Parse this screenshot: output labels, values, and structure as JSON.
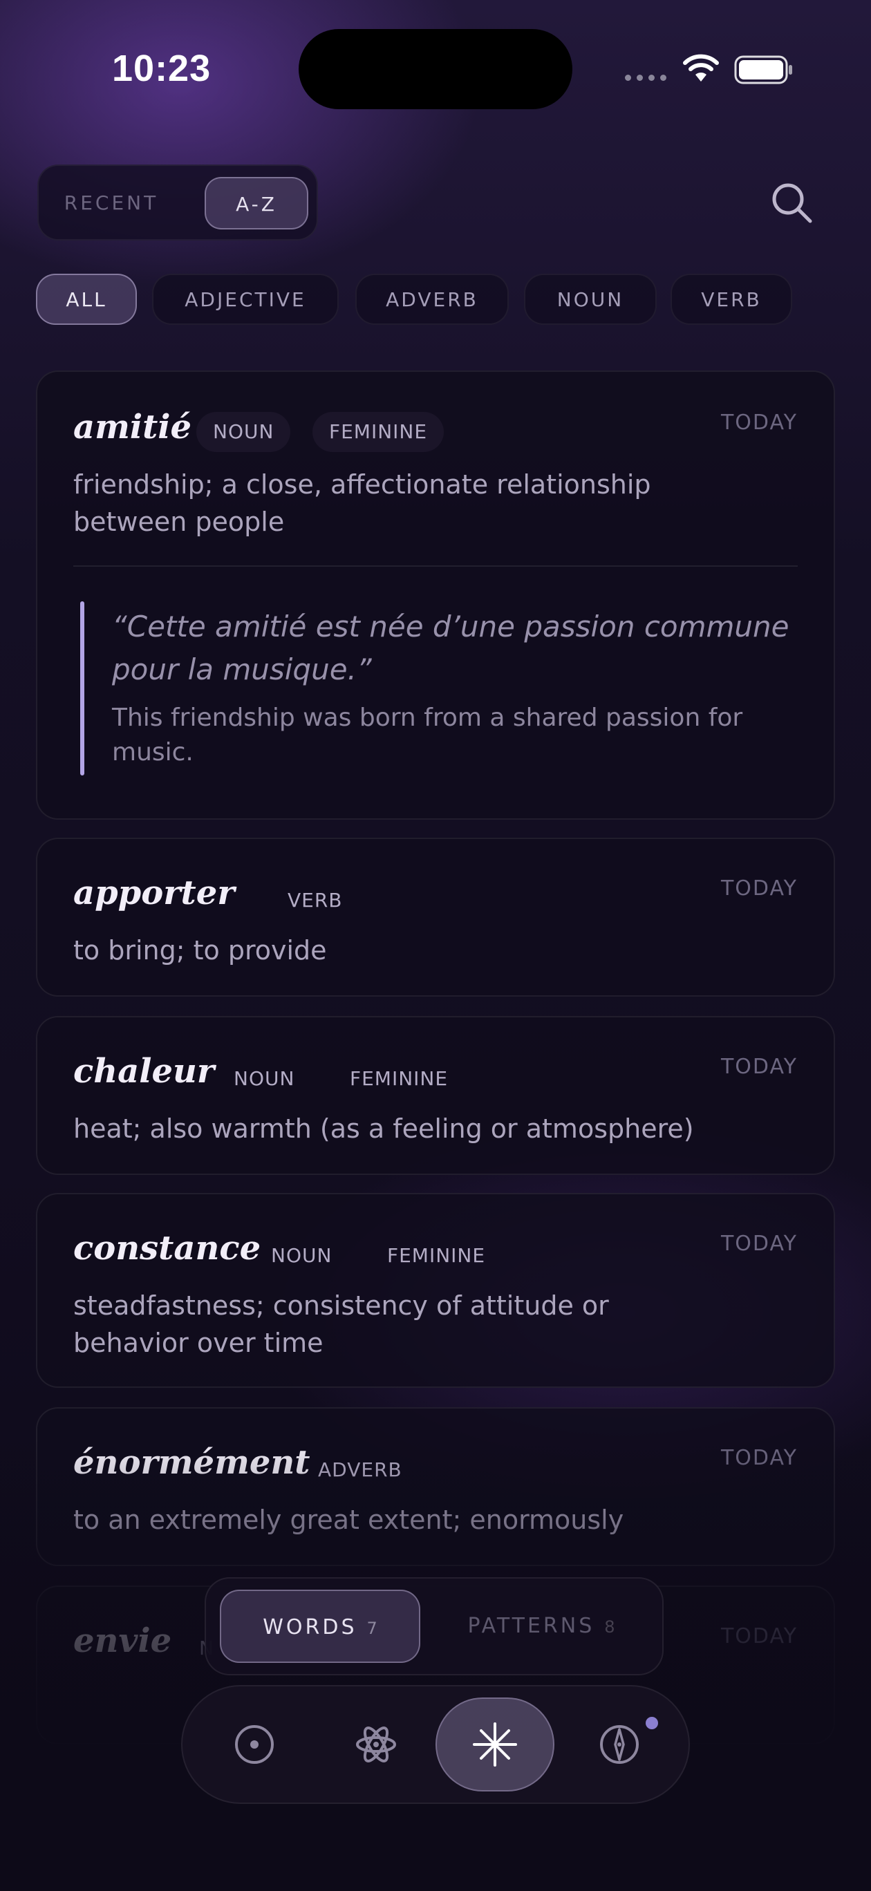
{
  "status_bar": {
    "time": "10:23"
  },
  "sort": {
    "options": [
      "RECENT",
      "A-Z"
    ],
    "selected": "A-Z"
  },
  "filters": {
    "items": [
      "ALL",
      "ADJECTIVE",
      "ADVERB",
      "NOUN",
      "VERB"
    ],
    "selected": "ALL"
  },
  "entries": [
    {
      "word": "amitié",
      "pos": "NOUN",
      "gender": "FEMININE",
      "date": "TODAY",
      "definition": "friendship; a close, affectionate relationship between people",
      "example": "“Cette amitié est née d’une passion commune pour la musique.”",
      "translation": "This friendship was born from a shared passion for music."
    },
    {
      "word": "apporter",
      "pos": "VERB",
      "date": "TODAY",
      "definition": "to bring; to provide"
    },
    {
      "word": "chaleur",
      "pos": "NOUN",
      "gender": "FEMININE",
      "date": "TODAY",
      "definition": "heat; also warmth (as a feeling or atmosphere)"
    },
    {
      "word": "constance",
      "pos": "NOUN",
      "gender": "FEMININE",
      "date": "TODAY",
      "definition": "steadfastness; consistency of attitude or behavior over time"
    },
    {
      "word": "énormément",
      "pos": "ADVERB",
      "date": "TODAY",
      "definition": "to an extremely great extent; enormously"
    },
    {
      "word": "envie",
      "pos": "N",
      "date": "TODAY"
    }
  ],
  "segment": {
    "words_label": "WORDS",
    "words_count": "7",
    "patterns_label": "PATTERNS",
    "patterns_count": "8",
    "selected": "WORDS"
  },
  "tabbar": {
    "tabs": [
      "target-icon",
      "atom-icon",
      "sparkle-icon",
      "compass-icon"
    ],
    "active": "sparkle-icon",
    "has_notification": true
  },
  "colors": {
    "accent": "#b3a5e6",
    "background": "#140f24",
    "card": "#100c1c"
  }
}
